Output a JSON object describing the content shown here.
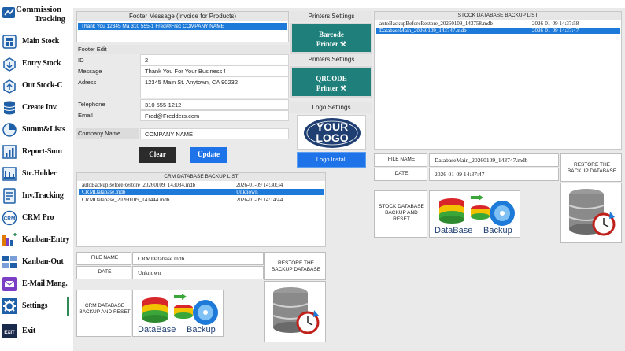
{
  "app": {
    "name_line1": "Commission",
    "name_line2": "Tracking"
  },
  "sidebar": {
    "items": [
      {
        "label": "Main Stock",
        "icon": "main-stock-icon"
      },
      {
        "label": "Entry Stock",
        "icon": "entry-stock-icon"
      },
      {
        "label": "Out Stock-C",
        "icon": "out-stock-icon"
      },
      {
        "label": "Create Inv.",
        "icon": "create-invoice-icon"
      },
      {
        "label": "Summ&Lists",
        "icon": "summary-chart-icon"
      },
      {
        "label": "Report-Sum",
        "icon": "report-icon"
      },
      {
        "label": "Stc.Holder",
        "icon": "stock-holder-icon"
      },
      {
        "label": "Inv.Tracking",
        "icon": "invoice-tracking-icon"
      },
      {
        "label": "CRM Pro",
        "icon": "crm-icon"
      },
      {
        "label": "Kanban-Entry",
        "icon": "kanban-entry-icon"
      },
      {
        "label": "Kanban-Out",
        "icon": "kanban-out-icon"
      },
      {
        "label": "E-Mail Mang.",
        "icon": "email-icon"
      },
      {
        "label": "Settings",
        "icon": "gear-icon"
      },
      {
        "label": "Exit",
        "icon": "exit-icon"
      }
    ],
    "active": "Settings"
  },
  "footer_message": {
    "title": "Footer Message (Invoice for Products)",
    "selected_row": "Thank You    12345 Ma    310 555-1    Fred@Frec    COMPANY NAME"
  },
  "footer_edit": {
    "title": "Footer Edit",
    "fields": [
      {
        "label": "ID",
        "value": "2"
      },
      {
        "label": "Message",
        "value": "Thank You For Your Business !"
      },
      {
        "label": "Adress",
        "value": "12345 Main St. Anytown, CA 90232"
      },
      {
        "label": "Telephone",
        "value": "310 555-1212"
      },
      {
        "label": "Email",
        "value": "Fred@Fredders.com"
      }
    ],
    "company_label": "Company Name",
    "company_value": "COMPANY NAME",
    "clear_label": "Clear",
    "update_label": "Update"
  },
  "printers": {
    "title1": "Printers Settings",
    "barcode_label_1": "Barcode",
    "barcode_label_2": "Printer ⚒",
    "title2": "Printers Settings",
    "qrcode_label_1": "QRCODE",
    "qrcode_label_2": "Printer ⚒",
    "logo_title": "Logo Settings",
    "logo_text_1": "YOUR",
    "logo_text_2": "LOGO",
    "logo_install": "Logo Install"
  },
  "stock_backup": {
    "title": "STOCK DATABASE BACKUP LIST",
    "rows": [
      {
        "name": "autoBackupBeforeRestore_20260109_143758.mdb",
        "date": "2026-01-09 14:37:58",
        "selected": false
      },
      {
        "name": "DatabaseMain_20260109_143747.mdb",
        "date": "2026-01-09 14:37:47",
        "selected": true
      }
    ],
    "file_name_label": "FILE NAME",
    "file_name_value": "DatabaseMain_20260109_143747.mdb",
    "date_label": "DATE",
    "date_value": "2026-01-09 14:37:47",
    "restore_label": "RESTORE THE BACKUP DATABASE",
    "backup_label": "STOCK DATABASE BACKUP AND RESET",
    "img_text_1": "DataBase",
    "img_text_2": "Backup"
  },
  "crm_backup": {
    "title": "CRM DATABASE BACKUP LIST",
    "rows": [
      {
        "name": "autoBackupBeforeRestore_20260109_143034.mdb",
        "date": "2026-01-09 14:30:34",
        "selected": false
      },
      {
        "name": "CRMDatabase.mdb",
        "date": "Unknown",
        "selected": true
      },
      {
        "name": "CRMDatabase_20260109_141444.mdb",
        "date": "2026-01-09 14:14:44",
        "selected": false
      }
    ],
    "file_name_label": "FILE NAME",
    "file_name_value": "CRMDatabase.mdb",
    "date_label": "DATE",
    "date_value": "Unknown",
    "restore_label": "RESTORE THE BACKUP DATABASE",
    "backup_label": "CRM DATABASE BACKUP AND RESET",
    "img_text_1": "DataBase",
    "img_text_2": "Backup"
  },
  "colors": {
    "teal": "#1f7f7a",
    "blue": "#1e73e8",
    "selection": "#1e7ad8",
    "panel_bg": "#eaeaea"
  }
}
